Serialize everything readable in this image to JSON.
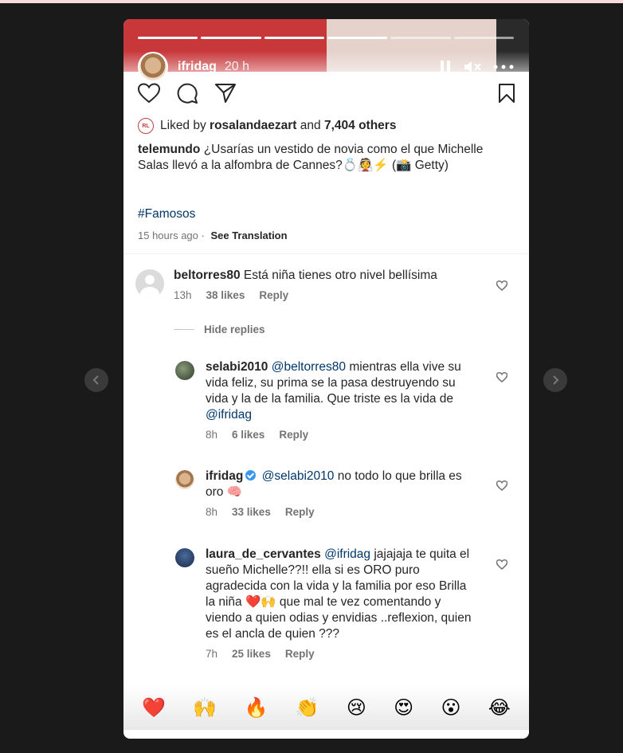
{
  "story": {
    "username": "ifridag",
    "time": "20 h"
  },
  "post": {
    "likes_prefix": "Liked by",
    "likes_user": "rosalandaezart",
    "likes_and": "and",
    "likes_count": "7,404 others",
    "likes_avatar_text": "RL",
    "caption_user": "telemundo",
    "caption_text": "¿Usarías un vestido de novia como el que Michelle Salas llevó a la alfombra de Cannes?💍👰⚡ (📸 Getty)",
    "hashtag": "#Famosos",
    "posted_ago": "15 hours ago",
    "see_translation": "See Translation"
  },
  "comments": [
    {
      "user": "beltorres80",
      "text": "Está niña tienes otro nivel bellísima",
      "time": "13h",
      "likes": "38 likes",
      "reply": "Reply"
    }
  ],
  "hide_replies": "Hide replies",
  "replies": [
    {
      "user": "selabi2010",
      "mention": "@beltorres80",
      "text": " mientras ella vive su vida feliz, su prima se la pasa destruyendo su vida y la de la familia. Que triste es la vida de ",
      "mention2": "@ifridag",
      "time": "8h",
      "likes": "6 likes",
      "reply": "Reply"
    },
    {
      "user": "ifridag",
      "mention": "@selabi2010",
      "text": " no todo lo que brilla es oro 🧠",
      "time": "8h",
      "likes": "33 likes",
      "reply": "Reply"
    },
    {
      "user": "laura_de_cervantes",
      "mention": "@ifridag",
      "text": " jajajaja te quita el sueño Michelle??!! ella si es ORO puro agradecida con la vida y la familia por eso Brilla la niña ❤️🙌 que mal te vez comentando y viendo a quien odias y envidias ..reflexion, quien es el ancla de quien ???",
      "time": "7h",
      "likes": "25 likes",
      "reply": "Reply"
    }
  ],
  "reactions": [
    "❤️",
    "🙌",
    "🔥",
    "👏",
    "😢",
    "😍",
    "😮",
    "😂"
  ],
  "icons": {
    "pause": "pause-icon",
    "mute": "mute-icon",
    "more": "more-icon",
    "like": "heart-icon",
    "comment": "comment-icon",
    "share": "send-icon",
    "save": "bookmark-icon",
    "prev": "chevron-left-icon",
    "next": "chevron-right-icon"
  },
  "colors": {
    "link": "#00376b",
    "secondary_text": "#737373",
    "verified": "#3897f0"
  }
}
